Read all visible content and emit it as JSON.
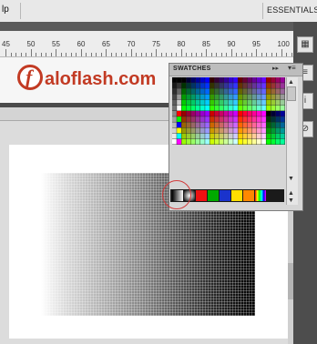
{
  "menubar": {
    "help_label": "lp",
    "workspace_label": "ESSENTIALS"
  },
  "ruler": {
    "ticks": [
      "45",
      "50",
      "55",
      "60",
      "65",
      "70",
      "75",
      "80",
      "85",
      "90",
      "95",
      "100"
    ]
  },
  "banner": {
    "logo_letter": "f",
    "logo_text": "aloflash.com",
    "brand_color": "#c23a23"
  },
  "swatches_panel": {
    "title": "SWATCHES",
    "collapse_icon": "double-chevron-right-icon",
    "menu_icon": "panel-menu-icon"
  },
  "right_tools": [
    {
      "name": "tool-swatches-icon",
      "glyph": "▦"
    },
    {
      "name": "tool-align-icon",
      "glyph": "≡"
    },
    {
      "name": "tool-info-icon",
      "glyph": "i"
    },
    {
      "name": "tool-transform-icon",
      "glyph": "⊘"
    }
  ],
  "gradient_swatches": [
    "#ffffff",
    "#bbbbbb",
    "#ee1111",
    "#00aa00",
    "#1a33cc",
    "#ffdd00",
    "#ff8800",
    "#66ccff"
  ],
  "annotation": {
    "highlight_color": "#d23b3b"
  }
}
